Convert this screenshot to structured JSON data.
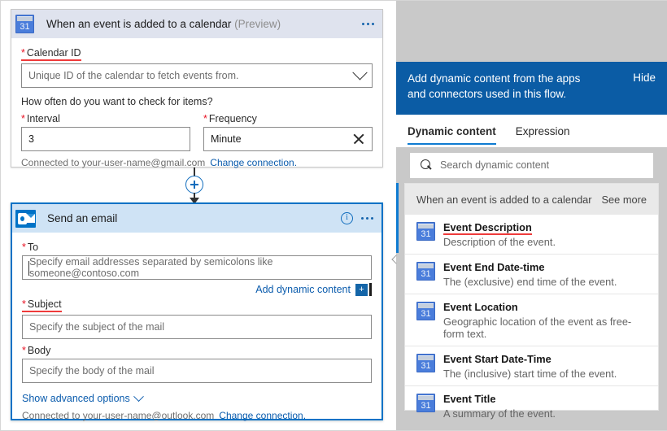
{
  "trigger_card": {
    "icon": "google-calendar-icon",
    "title": "When an event is added to a calendar",
    "preview_tag": "(Preview)",
    "menu_icon": "ellipsis-icon",
    "calendar_id": {
      "label": "Calendar ID",
      "required_marker": "*",
      "placeholder": "Unique ID of the calendar to fetch events from.",
      "dropdown_icon": "chevron-down-icon"
    },
    "question": "How often do you want to check for items?",
    "interval": {
      "label": "Interval",
      "required_marker": "*",
      "value": "3"
    },
    "frequency": {
      "label": "Frequency",
      "required_marker": "*",
      "value": "Minute",
      "clear_icon": "close-icon"
    },
    "connection_text": "Connected to your-user-name@gmail.com",
    "change_connection": "Change connection."
  },
  "connector": {
    "add_step_icon": "plus-circle-icon",
    "arrow_icon": "arrow-down-icon"
  },
  "action_card": {
    "icon": "outlook-icon",
    "title": "Send an email",
    "info_icon": "info-icon",
    "menu_icon": "ellipsis-icon",
    "to": {
      "label": "To",
      "required_marker": "*",
      "placeholder": "Specify email addresses separated by semicolons like someone@contoso.com"
    },
    "add_dynamic_content": {
      "label": "Add dynamic content",
      "badge": "+",
      "badge_icon": "plus-badge-icon"
    },
    "subject": {
      "label": "Subject",
      "required_marker": "*",
      "placeholder": "Specify the subject of the mail"
    },
    "body": {
      "label": "Body",
      "required_marker": "*",
      "placeholder": "Specify the body of the mail"
    },
    "show_advanced_options": "Show advanced options",
    "show_advanced_icon": "chevron-down-icon",
    "connection_text": "Connected to your-user-name@outlook.com",
    "change_connection": "Change connection."
  },
  "dynamic_panel": {
    "header_text": "Add dynamic content from the apps and connectors used in this flow.",
    "hide_label": "Hide",
    "collapse_icon": "chevron-left-icon",
    "tabs": [
      {
        "label": "Dynamic content",
        "active": true
      },
      {
        "label": "Expression",
        "active": false
      }
    ],
    "search": {
      "icon": "search-icon",
      "placeholder": "Search dynamic content"
    },
    "group": {
      "title": "When an event is added to a calendar",
      "see_more": "See more"
    },
    "items": [
      {
        "icon": "google-calendar-icon",
        "title": "Event Description",
        "desc": "Description of the event.",
        "highlighted": true
      },
      {
        "icon": "google-calendar-icon",
        "title": "Event End Date-time",
        "desc": "The (exclusive) end time of the event.",
        "highlighted": false
      },
      {
        "icon": "google-calendar-icon",
        "title": "Event Location",
        "desc": "Geographic location of the event as free-form text.",
        "highlighted": false
      },
      {
        "icon": "google-calendar-icon",
        "title": "Event Start Date-Time",
        "desc": "The (inclusive) start time of the event.",
        "highlighted": false
      },
      {
        "icon": "google-calendar-icon",
        "title": "Event Title",
        "desc": "A summary of the event.",
        "highlighted": false
      }
    ]
  },
  "colors": {
    "accent_blue": "#0b5ca5",
    "link_blue": "#0b5cad",
    "selected_border": "#0072c6",
    "required_red": "#e81123",
    "highlight_red": "#ef3b3b",
    "calendar_icon_blue": "#4a7ddb",
    "outlook_blue": "#0072c6"
  },
  "calendar_icon_day": "31"
}
